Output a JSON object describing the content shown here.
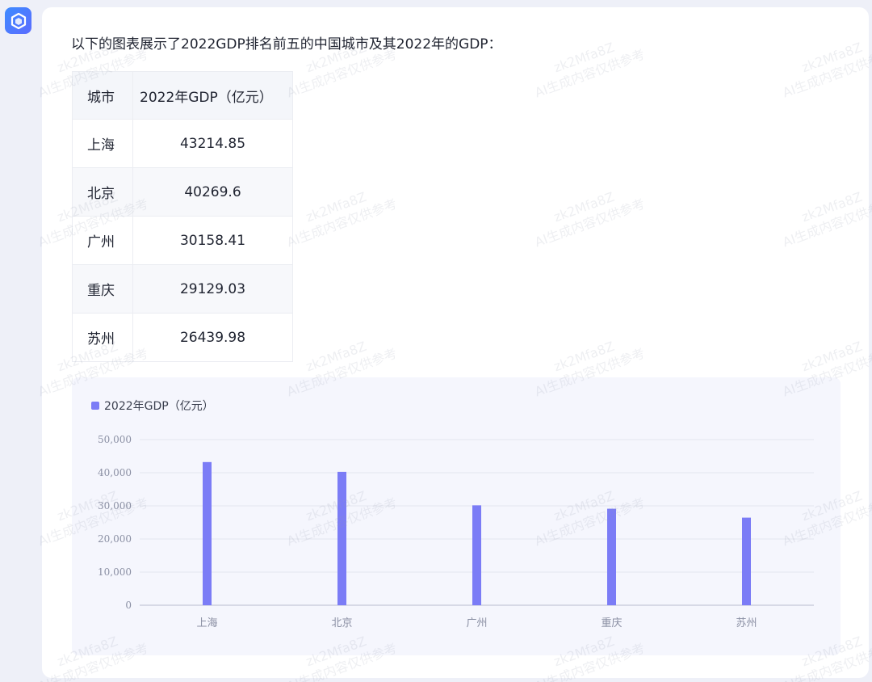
{
  "message": {
    "intro": "以下的图表展示了2022GDP排名前五的中国城市及其2022年的GDP："
  },
  "table": {
    "headers": [
      "城市",
      "2022年GDP（亿元）"
    ],
    "rows": [
      [
        "上海",
        "43214.85"
      ],
      [
        "北京",
        "40269.6"
      ],
      [
        "广州",
        "30158.41"
      ],
      [
        "重庆",
        "29129.03"
      ],
      [
        "苏州",
        "26439.98"
      ]
    ]
  },
  "chart_data": {
    "type": "bar",
    "categories": [
      "上海",
      "北京",
      "广州",
      "重庆",
      "苏州"
    ],
    "series": [
      {
        "name": "2022年GDP（亿元）",
        "values": [
          43214.85,
          40269.6,
          30158.41,
          29129.03,
          26439.98
        ],
        "color": "#7b7cf6"
      }
    ],
    "ylim": [
      0,
      50000
    ],
    "yticks": [
      0,
      10000,
      20000,
      30000,
      40000,
      50000
    ],
    "ytick_labels": [
      "0",
      "10,000",
      "20,000",
      "30,000",
      "40,000",
      "50,000"
    ],
    "grid": true,
    "legend": "top-left"
  },
  "watermark": {
    "line1": "zk2Mfa8Z",
    "line2": "AI生成内容仅供参考"
  },
  "colors": {
    "accent": "#7b7cf6",
    "app_icon": "#4f7dff"
  }
}
